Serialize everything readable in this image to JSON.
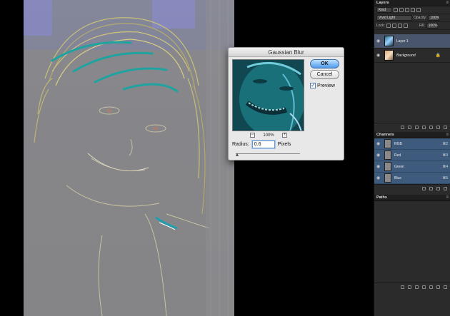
{
  "dialog": {
    "title": "Gaussian Blur",
    "ok_label": "OK",
    "cancel_label": "Cancel",
    "preview_label": "Preview",
    "preview_checked": true,
    "zoom_level": "100%",
    "zoom_out": "−",
    "zoom_in": "+",
    "radius_label": "Radius:",
    "radius_value": "0.6",
    "radius_unit": "Pixels"
  },
  "layers_panel": {
    "tab": "Layers",
    "filter_kind": "Kind",
    "blend_mode": "Vivid Light",
    "opacity_label": "Opacity:",
    "opacity_value": "100%",
    "lock_label": "Lock:",
    "fill_label": "Fill:",
    "fill_value": "100%",
    "layers": [
      {
        "name": "Layer 1",
        "selected": true
      },
      {
        "name": "Background",
        "selected": false
      }
    ]
  },
  "channels_panel": {
    "tab": "Channels",
    "channels": [
      {
        "name": "RGB",
        "shortcut": "⌘2"
      },
      {
        "name": "Red",
        "shortcut": "⌘3"
      },
      {
        "name": "Green",
        "shortcut": "⌘4"
      },
      {
        "name": "Blue",
        "shortcut": "⌘5"
      }
    ]
  },
  "paths_panel": {
    "tab": "Paths"
  },
  "icons": {
    "eye": "eye-icon",
    "lock": "lock-icon",
    "panel_menu": "menu-icon"
  },
  "colors": {
    "accent_blue": "#4e9bec",
    "channel_selected": "#3e5a7d",
    "panel_bg": "#2b2b2b"
  }
}
